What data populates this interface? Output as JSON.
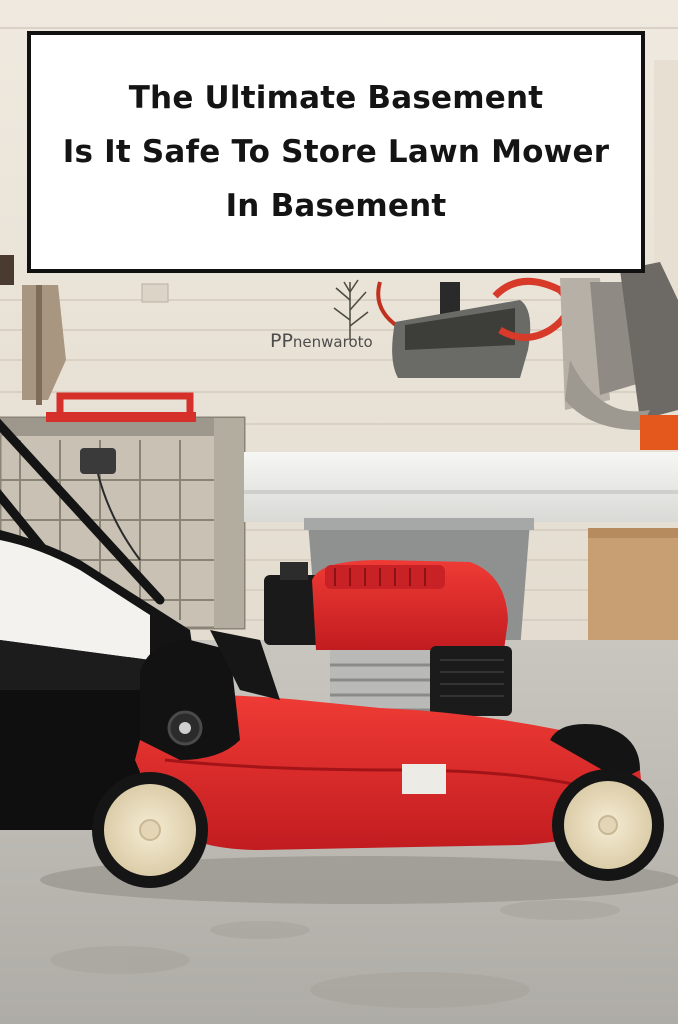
{
  "title": {
    "line1": "The Ultimate Basement",
    "line2": "Is It Safe To Store Lawn Mower",
    "line3": "In Basement"
  },
  "watermark": {
    "prefix": "PP",
    "rest": "nenwaroto"
  },
  "colors": {
    "mower_red": "#e0262a",
    "wall": "#e8e2d6",
    "floor": "#bdbab3",
    "wheel": "#efe3c8"
  },
  "icons": {
    "mower": "lawn-mower-illustration",
    "gas_can": "gas-can-illustration",
    "hanging_tools": "hanging-tools-illustration"
  }
}
